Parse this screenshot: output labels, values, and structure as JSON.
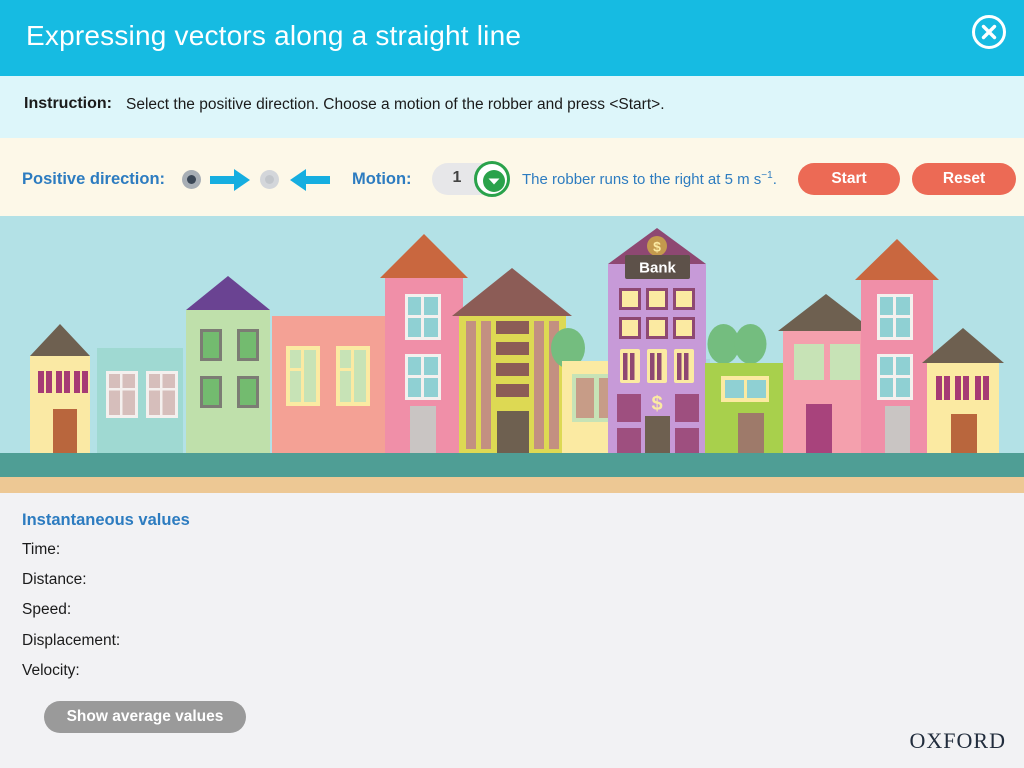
{
  "header": {
    "title": "Expressing vectors along a straight line",
    "close_icon": "close-circle-icon",
    "bg_color": "#16bbe2"
  },
  "instruction": {
    "label": "Instruction:",
    "text": "Select the positive direction. Choose a motion of the robber and press <Start>.",
    "bg_color": "#ddf6fa"
  },
  "controls": {
    "positive_direction_label": "Positive direction:",
    "direction_options": [
      {
        "icon": "arrow-right-icon",
        "selected": true
      },
      {
        "icon": "arrow-left-icon",
        "selected": false
      }
    ],
    "motion_label": "Motion:",
    "motion_value": "1",
    "motion_chevron_icon": "chevron-down-icon",
    "motion_description_prefix": "The robber runs to the right at 5 m s",
    "motion_description_exponent": "−1",
    "motion_description_suffix": ".",
    "start_label": "Start",
    "reset_label": "Reset",
    "button_color": "#ec6a55",
    "accent_color": "#2d7cc0",
    "bg_color": "#fdf8e8"
  },
  "scene": {
    "direction_indicator_icon": "arrow-right-icon",
    "direction_indicator_sign": "+",
    "sky_color": "#b3e1e6",
    "sidewalk_color": "#4f9e95",
    "road_color": "#edc894",
    "bank_sign_label": "Bank",
    "bank_currency_icon": "dollar-sign-icon"
  },
  "values_panel": {
    "title": "Instantaneous values",
    "rows": [
      {
        "label": "Time:",
        "value": ""
      },
      {
        "label": "Distance:",
        "value": ""
      },
      {
        "label": "Speed:",
        "value": ""
      },
      {
        "label": "Displacement:",
        "value": ""
      },
      {
        "label": "Velocity:",
        "value": ""
      }
    ],
    "show_average_label": "Show average values",
    "bg_color": "#f2f2f4"
  },
  "footer": {
    "brand": "OXFORD"
  }
}
